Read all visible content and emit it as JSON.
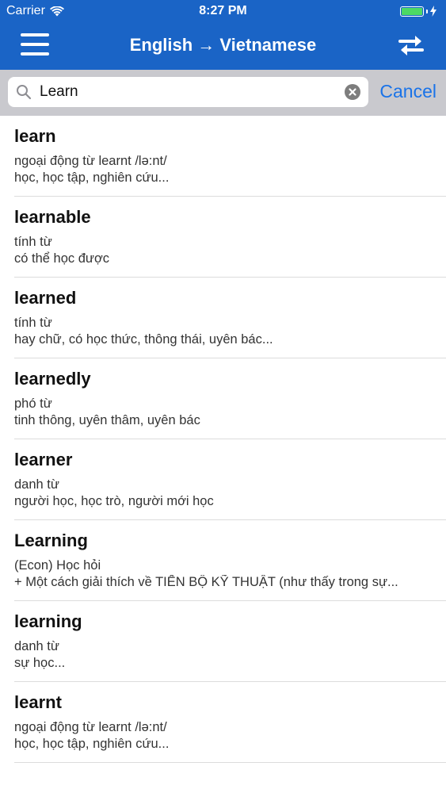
{
  "status": {
    "carrier": "Carrier",
    "time": "8:27 PM"
  },
  "nav": {
    "title": "English → Vietnamese",
    "menu_icon": "menu-icon",
    "swap_icon": "swap-icon"
  },
  "search": {
    "value": "Learn",
    "placeholder": "",
    "cancel_label": "Cancel"
  },
  "colors": {
    "nav_bg": "#1a64c6",
    "accent": "#1a73e8",
    "search_bar_bg": "#c9c9ce"
  },
  "results": [
    {
      "word": "learn",
      "line1": "ngoại động từ learnt  /lə:nt/",
      "line2": "học, học tập, nghiên cứu..."
    },
    {
      "word": "learnable",
      "line1": "tính từ",
      "line2": "có thể học được"
    },
    {
      "word": "learned",
      "line1": "tính từ",
      "line2": "hay chữ, có học thức, thông thái, uyên bác..."
    },
    {
      "word": "learnedly",
      "line1": "phó từ",
      "line2": "tinh thông, uyên thâm, uyên bác"
    },
    {
      "word": "learner",
      "line1": "danh từ",
      "line2": "người học, học trò, người mới học"
    },
    {
      "word": "Learning",
      "line1": "(Econ) Học hỏi",
      "line2": "+ Một cách giải thích về TIẾN BỘ KỸ THUẬT (như thấy trong sự..."
    },
    {
      "word": "learning",
      "line1": "danh từ",
      "line2": "sự học..."
    },
    {
      "word": "learnt",
      "line1": "ngoại động từ learnt  /lə:nt/",
      "line2": "học, học tập, nghiên cứu..."
    }
  ]
}
